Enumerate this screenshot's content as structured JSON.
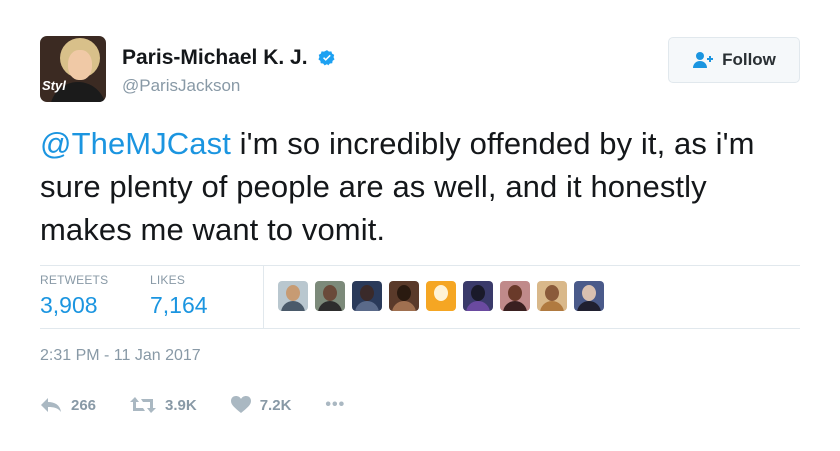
{
  "user": {
    "display_name": "Paris-Michael K. J.",
    "handle": "@ParisJackson",
    "avatar_badge": "Styl",
    "verified": true
  },
  "follow_button": {
    "label": "Follow",
    "icon": "follow-user-icon"
  },
  "tweet": {
    "mention": "@TheMJCast",
    "body": " i'm so incredibly offended by it, as i'm sure plenty of people are as well, and it honestly makes me want to vomit."
  },
  "stats": {
    "retweets_label": "RETWEETS",
    "retweets_value": "3,908",
    "likes_label": "LIKES",
    "likes_value": "7,164"
  },
  "likers": [
    {
      "bg": "#b9c7cf",
      "head": "#c79b73",
      "body": "#4a5a6a"
    },
    {
      "bg": "#7c8a7a",
      "head": "#6a4a3a",
      "body": "#2d2d2d"
    },
    {
      "bg": "#2a3a5a",
      "head": "#3a2a2a",
      "body": "#5a6a8a"
    },
    {
      "bg": "#5a3a2a",
      "head": "#2a1a10",
      "body": "#a07050"
    },
    {
      "bg": "#f5a623",
      "head": "#fff3d6",
      "body": "#f5a623"
    },
    {
      "bg": "#3a3a6a",
      "head": "#1a1a2a",
      "body": "#6a4aa0"
    },
    {
      "bg": "#c08a8a",
      "head": "#6a3a2a",
      "body": "#3a2020"
    },
    {
      "bg": "#d9b88a",
      "head": "#8a5a3a",
      "body": "#b07a40"
    },
    {
      "bg": "#4a5a8a",
      "head": "#d9c0b0",
      "body": "#202030"
    }
  ],
  "timestamp": "2:31 PM - 11 Jan 2017",
  "actions": {
    "reply_count": "266",
    "retweet_count": "3.9K",
    "like_count": "7.2K",
    "more_label": "•••"
  },
  "colors": {
    "link_blue": "#1b95e0",
    "muted_gray": "#8899a6",
    "verified_blue": "#1da1f2"
  }
}
